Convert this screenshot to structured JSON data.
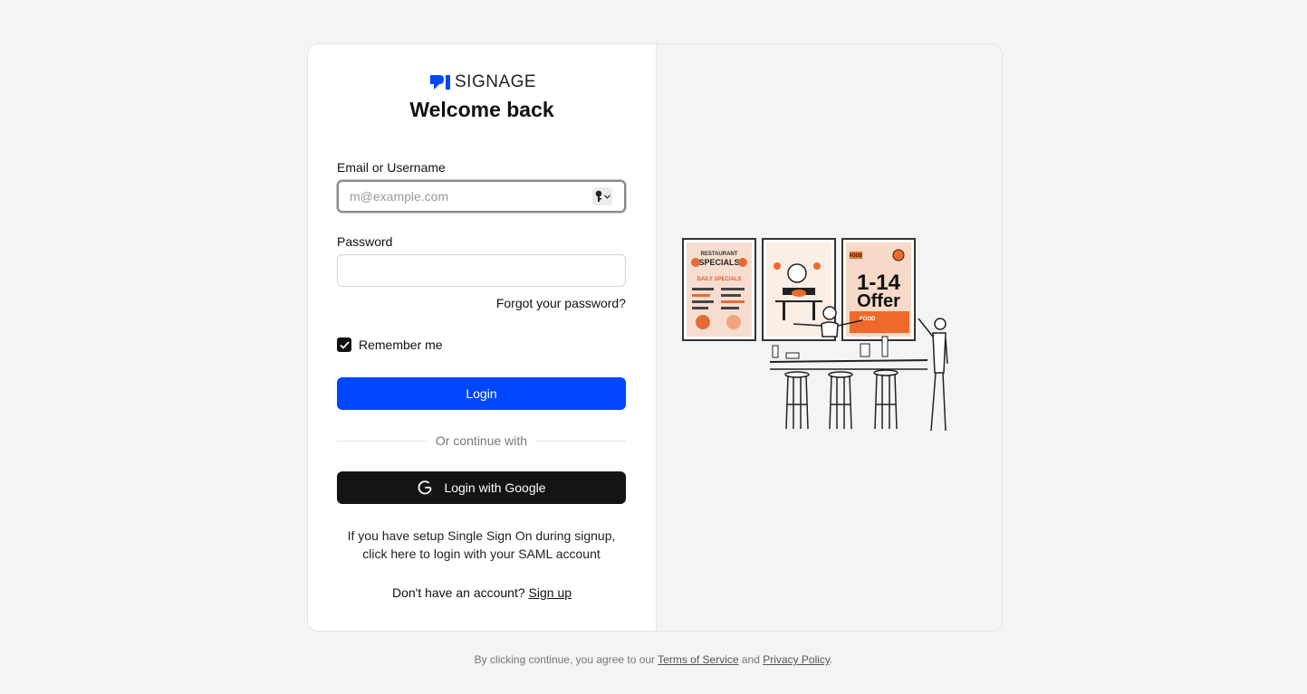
{
  "brand": {
    "name": "SIGNAGE",
    "accent": "#0047ff"
  },
  "title": "Welcome back",
  "email": {
    "label": "Email or Username",
    "placeholder": "m@example.com",
    "value": ""
  },
  "password": {
    "label": "Password",
    "value": ""
  },
  "forgot_link": "Forgot your password?",
  "remember": {
    "label": "Remember me",
    "checked": true
  },
  "login_button": "Login",
  "divider_text": "Or continue with",
  "google_button": "Login with Google",
  "sso": {
    "line1": "If you have setup Single Sign On during signup,",
    "line2": "click here to login with your SAML account"
  },
  "signup": {
    "prompt": "Don't have an account?",
    "link": "Sign up"
  },
  "footer": {
    "prefix": "By clicking continue, you agree to our",
    "terms": "Terms of Service",
    "and": "and",
    "privacy": "Privacy Policy",
    "suffix": "."
  },
  "illustration": {
    "poster1": {
      "title": "RESTAURANT",
      "heading": "SPECIALS",
      "line": "DAILY SPECIALS"
    },
    "poster3": {
      "top": "FOOD",
      "offer_line1": "1-14",
      "offer_line2": "Offer",
      "bottom": "FOOD"
    }
  },
  "icons": [
    "brand-logo-icon",
    "key-icon",
    "chevron-down-icon",
    "check-icon",
    "google-icon"
  ]
}
